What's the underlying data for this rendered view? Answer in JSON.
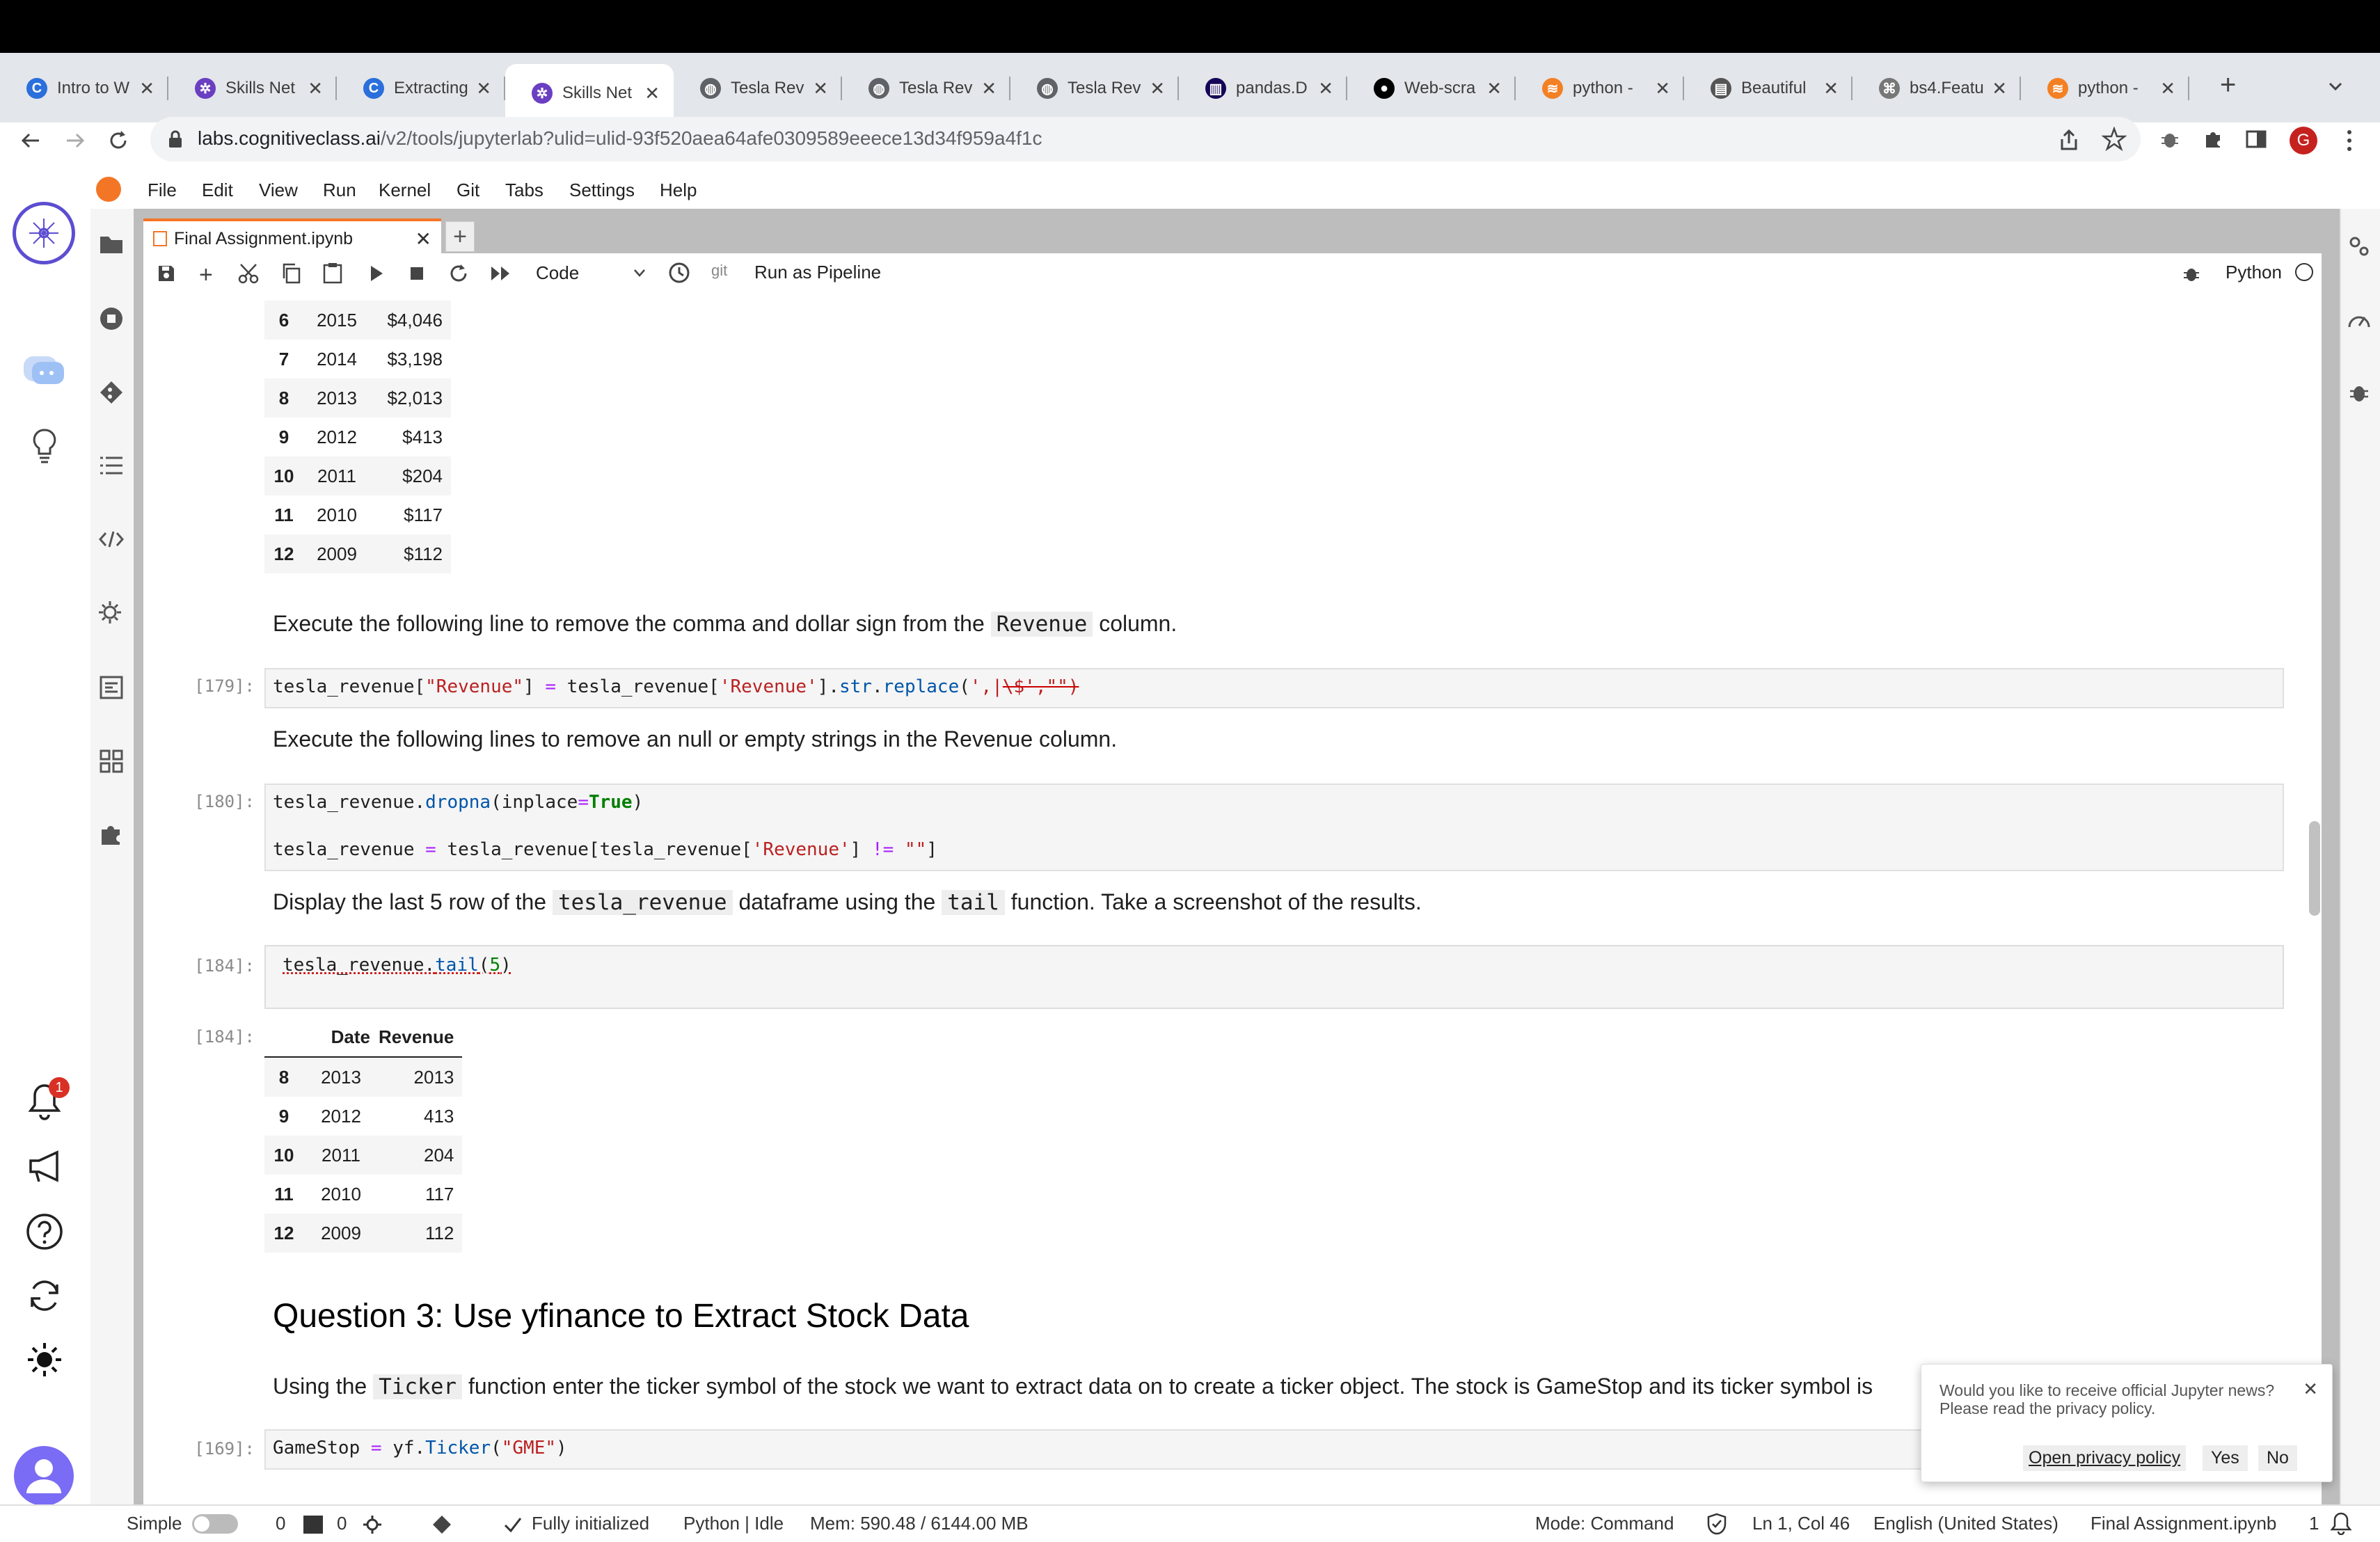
{
  "browser": {
    "tabs": [
      {
        "label": "Intro to W",
        "fav": "C",
        "color": "#2a6fdb"
      },
      {
        "label": "Skills Net",
        "fav": "✲",
        "color": "#6a3fc1"
      },
      {
        "label": "Extracting",
        "fav": "C",
        "color": "#2a6fdb"
      },
      {
        "label": "Skills Net",
        "fav": "✲",
        "color": "#6a3fc1",
        "active": true
      },
      {
        "label": "Tesla Rev",
        "fav": "◍",
        "color": "#5f6368"
      },
      {
        "label": "Tesla Rev",
        "fav": "◍",
        "color": "#5f6368"
      },
      {
        "label": "Tesla Rev",
        "fav": "◍",
        "color": "#5f6368"
      },
      {
        "label": "pandas.D",
        "fav": "▥",
        "color": "#150458"
      },
      {
        "label": "Web-scra",
        "fav": "●",
        "color": "#000000"
      },
      {
        "label": "python -",
        "fav": "≋",
        "color": "#f48024"
      },
      {
        "label": "Beautiful",
        "fav": "▤",
        "color": "#555555"
      },
      {
        "label": "bs4.Featu",
        "fav": "⌘",
        "color": "#777777"
      },
      {
        "label": "python -",
        "fav": "≋",
        "color": "#f48024"
      }
    ],
    "close_glyph": "✕",
    "new_tab": "+",
    "url_host": "labs.cognitiveclass.ai",
    "url_path": "/v2/tools/jupyterlab?ulid=ulid-93f520aea64afe0309589eeece13d34f959a4f1c",
    "profile_initial": "G"
  },
  "menu": [
    "File",
    "Edit",
    "View",
    "Run",
    "Kernel",
    "Git",
    "Tabs",
    "Settings",
    "Help"
  ],
  "notebook": {
    "tab_title": "Final Assignment.ipynb",
    "cell_type": "Code",
    "git_label": "git",
    "pipeline_label": "Run as Pipeline",
    "kernel_name": "Python",
    "table1_rows": [
      [
        "6",
        "2015",
        "$4,046"
      ],
      [
        "7",
        "2014",
        "$3,198"
      ],
      [
        "8",
        "2013",
        "$2,013"
      ],
      [
        "9",
        "2012",
        "$413"
      ],
      [
        "10",
        "2011",
        "$204"
      ],
      [
        "11",
        "2010",
        "$117"
      ],
      [
        "12",
        "2009",
        "$112"
      ]
    ],
    "md1_a": "Execute the following line to remove the comma and dollar sign from the",
    "md1_code": "Revenue",
    "md1_b": "column.",
    "p179": "[179]:",
    "c179_a": "tesla_revenue[",
    "c179_b": "\"Revenue\"",
    "c179_c": "] ",
    "c179_d": "=",
    "c179_e": " tesla_revenue[",
    "c179_f": "'Revenue'",
    "c179_g": "].",
    "c179_h": "str",
    "c179_i": ".",
    "c179_j": "replace",
    "c179_k": "(",
    "c179_l": "',|",
    "c179_m": "\\$',\"\")",
    "md2": "Execute the following lines to remove an null or empty strings in the Revenue column.",
    "p180": "[180]:",
    "c180_l1_a": "tesla_revenue.",
    "c180_l1_b": "dropna",
    "c180_l1_c": "(inplace",
    "c180_l1_d": "=",
    "c180_l1_e": "True",
    "c180_l1_f": ")",
    "c180_l2_a": "tesla_revenue ",
    "c180_l2_b": "=",
    "c180_l2_c": " tesla_revenue[tesla_revenue[",
    "c180_l2_d": "'Revenue'",
    "c180_l2_e": "] ",
    "c180_l2_f": "!=",
    "c180_l2_g": " ",
    "c180_l2_h": "\"\"",
    "c180_l2_i": "]",
    "md3_a": "Display the last 5 row of the",
    "md3_code1": "tesla_revenue",
    "md3_b": "dataframe using the",
    "md3_code2": "tail",
    "md3_c": "function. Take a screenshot of the results.",
    "p184": "[184]:",
    "c184_a": "tesla_revenue.",
    "c184_b": "tail",
    "c184_c": "(",
    "c184_d": "5",
    "c184_e": ")",
    "p184_out": "[184]:",
    "table2_headers": [
      "Date",
      "Revenue"
    ],
    "table2_rows": [
      [
        "8",
        "2013",
        "2013"
      ],
      [
        "9",
        "2012",
        "413"
      ],
      [
        "10",
        "2011",
        "204"
      ],
      [
        "11",
        "2010",
        "117"
      ],
      [
        "12",
        "2009",
        "112"
      ]
    ],
    "q3_title": "Question 3: Use yfinance to Extract Stock Data",
    "md4_a": "Using the",
    "md4_code": "Ticker",
    "md4_b": "function enter the ticker symbol of the stock we want to extract data on to create a ticker object. The stock is GameStop and its ticker symbol is",
    "p169": "[169]:",
    "c169_a": "GameStop ",
    "c169_b": "=",
    "c169_c": " yf.",
    "c169_d": "Ticker",
    "c169_e": "(",
    "c169_f": "\"GME\"",
    "c169_g": ")"
  },
  "popup": {
    "text1": "Would you like to receive official Jupyter news?",
    "text2": "Please read the privacy policy.",
    "link": "Open privacy policy",
    "yes": "Yes",
    "no": "No",
    "close": "✕"
  },
  "status": {
    "mode_label": "Simple",
    "zero1": "0",
    "zero2": "0",
    "init": "Fully initialized",
    "kernel": "Python | Idle",
    "mem": "Mem: 590.48 / 6144.00 MB",
    "mode": "Mode: Command",
    "pos": "Ln 1, Col 46",
    "lang": "English (United States)",
    "file": "Final Assignment.ipynb",
    "count": "1"
  },
  "notification_badge": "1",
  "icons": [
    "back-icon",
    "forward-icon",
    "reload-icon",
    "lock-icon",
    "share-icon",
    "star-icon",
    "extension-icon",
    "puzzle-icon",
    "sidepanel-icon",
    "menu-icon",
    "folder-icon",
    "stop-icon",
    "git-icon",
    "toc-icon",
    "code-icon",
    "settings-icon",
    "bell-icon",
    "megaphone-icon",
    "help-icon",
    "sync-icon",
    "sun-icon",
    "avatar-icon"
  ]
}
